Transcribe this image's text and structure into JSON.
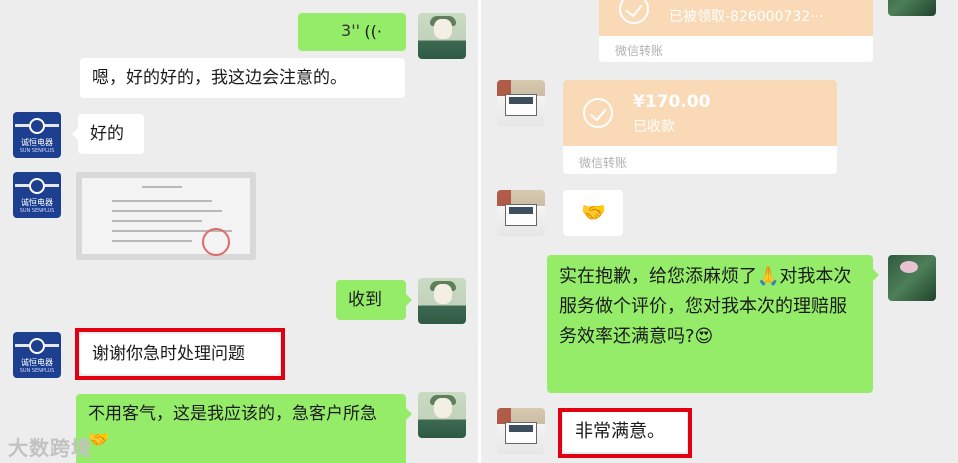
{
  "left_chat": {
    "voice_message": {
      "duration": "3''",
      "wave_icon": "voice-wave-icon"
    },
    "messages": [
      {
        "sender": "me",
        "text": "嗯，好的好的，我这边会注意的。"
      },
      {
        "sender": "them",
        "text": "好的"
      },
      {
        "sender": "them",
        "type": "image"
      },
      {
        "sender": "me",
        "text": "收到"
      },
      {
        "sender": "them",
        "text": "谢谢你急时处理问题"
      },
      {
        "sender": "me",
        "text": "不用客气，这是我应该的，急客户所急🤝"
      }
    ],
    "brand_text_line1": "诚恒电器",
    "brand_text_line2": "SUN SENPLUS",
    "watermark": "大数跨境"
  },
  "right_chat": {
    "transfer_1": {
      "status": "已被领取-826000732···",
      "footer": "微信转账"
    },
    "transfer_2": {
      "amount": "¥170.00",
      "status": "已收款",
      "footer": "微信转账"
    },
    "handshake_emoji": "🤝",
    "survey_message": "实在抱歉，给您添麻烦了🙏对我本次服务做个评价，您对我本次的理赔服务效率还满意吗?😍",
    "reply": "非常满意。"
  },
  "colors": {
    "chat_bg": "#ededed",
    "my_bubble": "#95ec69",
    "their_bubble": "#ffffff",
    "transfer_card": "#f9d9b6",
    "highlight_box": "#e00012"
  }
}
